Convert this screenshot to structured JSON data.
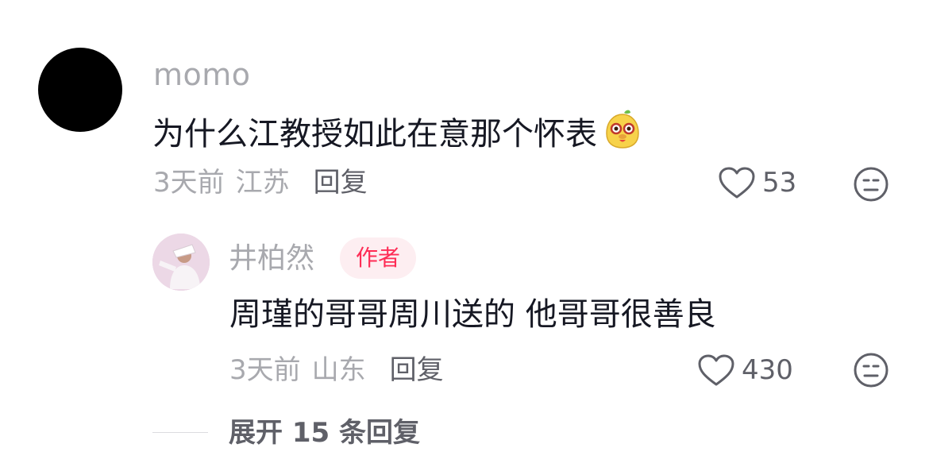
{
  "comment": {
    "username": "momo",
    "text": "为什么江教授如此在意那个怀表",
    "emoji_icon": "cute-face-emoji",
    "time": "3天前",
    "location": "江苏",
    "reply_label": "回复",
    "likes": "53",
    "reply": {
      "username": "井柏然",
      "badge": "作者",
      "text": "周瑾的哥哥周川送的 他哥哥很善良",
      "time": "3天前",
      "location": "山东",
      "reply_label": "回复",
      "likes": "430"
    }
  },
  "expand_replies_label": "展开 15 条回复",
  "colors": {
    "primary_text": "#161823",
    "secondary_text": "#a8a9ae",
    "action_text": "#5f6068",
    "author_badge_text": "#fe2c55",
    "author_badge_bg": "#fdeef1"
  }
}
